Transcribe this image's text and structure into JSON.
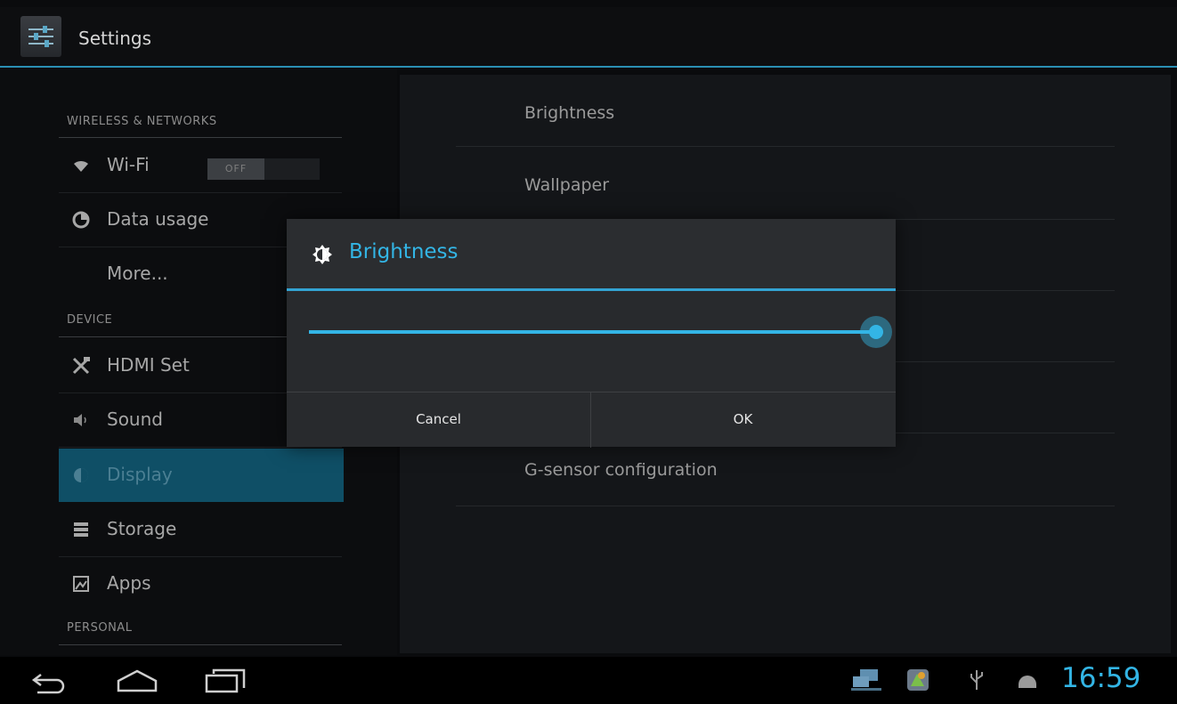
{
  "app": {
    "title": "Settings"
  },
  "sidebar": {
    "sections": [
      {
        "header": "WIRELESS & NETWORKS"
      },
      {
        "header": "DEVICE"
      },
      {
        "header": "PERSONAL"
      }
    ],
    "items": [
      {
        "label": "Wi-Fi",
        "icon": "wifi-icon",
        "toggle": "OFF"
      },
      {
        "label": "Data usage",
        "icon": "data-usage-icon"
      },
      {
        "label": "More..."
      },
      {
        "label": "HDMI Set",
        "icon": "tools-icon"
      },
      {
        "label": "Sound",
        "icon": "speaker-icon"
      },
      {
        "label": "Display",
        "icon": "display-icon",
        "selected": true
      },
      {
        "label": "Storage",
        "icon": "storage-icon"
      },
      {
        "label": "Apps",
        "icon": "apps-icon"
      }
    ]
  },
  "display_settings": {
    "items": [
      {
        "label": "Brightness"
      },
      {
        "label": "Wallpaper"
      },
      {
        "label": "G-sensor configuration"
      }
    ]
  },
  "dialog": {
    "title": "Brightness",
    "icon": "brightness-icon",
    "slider_value": 1.0,
    "cancel_label": "Cancel",
    "ok_label": "OK"
  },
  "nav_bar": {
    "back_icon": "back-icon",
    "home_icon": "home-icon",
    "recents_icon": "recents-icon"
  },
  "status_bar": {
    "time": "16:59",
    "icons": [
      "network-icon",
      "app-notification-icon",
      "usb-icon",
      "android-debug-icon"
    ]
  },
  "colors": {
    "accent": "#33b5e5",
    "selected_bg": "#0f4f66"
  }
}
